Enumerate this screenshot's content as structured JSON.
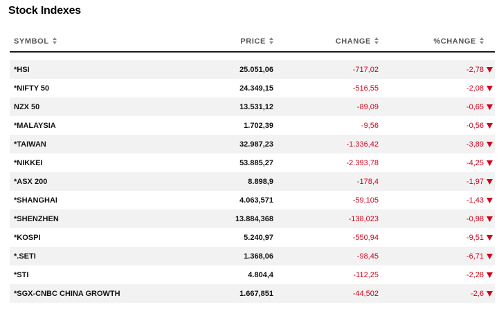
{
  "title": "Stock Indexes",
  "headers": {
    "symbol": "SYMBOL",
    "price": "PRICE",
    "change": "CHANGE",
    "pct_change": "%CHANGE"
  },
  "colors": {
    "negative": "#d0021b",
    "header_text": "#555555",
    "alt_row": "#f2f2f2"
  },
  "icons": {
    "sort": "sort-arrows-icon",
    "direction": "down-triangle-icon"
  },
  "rows": [
    {
      "symbol": "*HSI",
      "price": "25.051,06",
      "change": "-717,02",
      "pct": "-2,78",
      "direction": "down"
    },
    {
      "symbol": "*NIFTY 50",
      "price": "24.349,15",
      "change": "-516,55",
      "pct": "-2,08",
      "direction": "down"
    },
    {
      "symbol": "NZX 50",
      "price": "13.531,12",
      "change": "-89,09",
      "pct": "-0,65",
      "direction": "down"
    },
    {
      "symbol": "*MALAYSIA",
      "price": "1.702,39",
      "change": "-9,56",
      "pct": "-0,56",
      "direction": "down"
    },
    {
      "symbol": "*TAIWAN",
      "price": "32.987,23",
      "change": "-1.336,42",
      "pct": "-3,89",
      "direction": "down"
    },
    {
      "symbol": "*NIKKEI",
      "price": "53.885,27",
      "change": "-2.393,78",
      "pct": "-4,25",
      "direction": "down"
    },
    {
      "symbol": "*ASX 200",
      "price": "8.898,9",
      "change": "-178,4",
      "pct": "-1,97",
      "direction": "down"
    },
    {
      "symbol": "*SHANGHAI",
      "price": "4.063,571",
      "change": "-59,105",
      "pct": "-1,43",
      "direction": "down"
    },
    {
      "symbol": "*SHENZHEN",
      "price": "13.884,368",
      "change": "-138,023",
      "pct": "-0,98",
      "direction": "down"
    },
    {
      "symbol": "*KOSPI",
      "price": "5.240,97",
      "change": "-550,94",
      "pct": "-9,51",
      "direction": "down"
    },
    {
      "symbol": "*.SETI",
      "price": "1.368,06",
      "change": "-98,45",
      "pct": "-6,71",
      "direction": "down"
    },
    {
      "symbol": "*STI",
      "price": "4.804,4",
      "change": "-112,25",
      "pct": "-2,28",
      "direction": "down"
    },
    {
      "symbol": "*SGX-CNBC CHINA GROWTH",
      "price": "1.667,851",
      "change": "-44,502",
      "pct": "-2,6",
      "direction": "down"
    }
  ]
}
